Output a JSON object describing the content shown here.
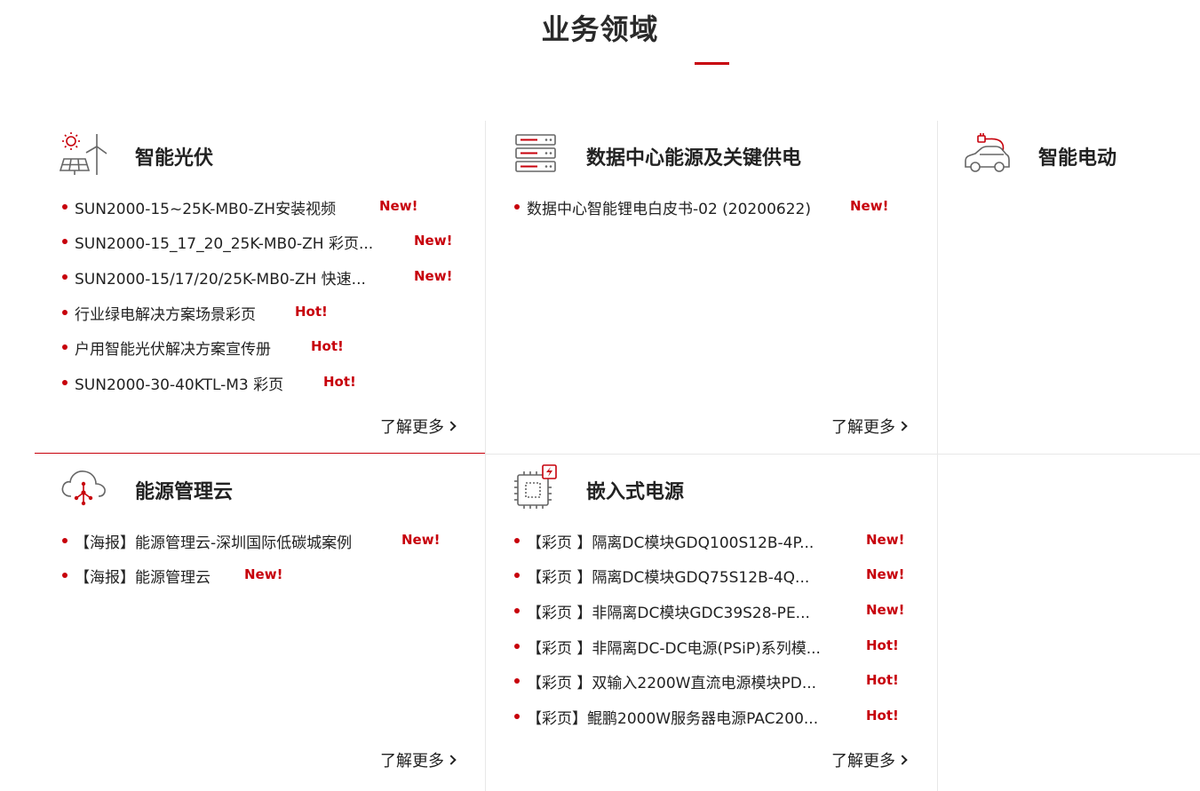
{
  "page": {
    "title": "业务领域"
  },
  "colors": {
    "accent": "#c7000b",
    "text": "#222222",
    "grid": "#e8e8e8"
  },
  "more_label": "了解更多",
  "cards": [
    {
      "id": "pv",
      "title": "智能光伏",
      "icon": "solar-wind-icon",
      "items": [
        {
          "text": "SUN2000-15~25K-MB0-ZH安装视频",
          "tag": "New!"
        },
        {
          "text": "SUN2000-15_17_20_25K-MB0-ZH 彩页...",
          "tag": "New!"
        },
        {
          "text": "SUN2000-15/17/20/25K-MB0-ZH 快速...",
          "tag": "New!"
        },
        {
          "text": "行业绿电解决方案场景彩页",
          "tag": "Hot!"
        },
        {
          "text": "户用智能光伏解决方案宣传册",
          "tag": "Hot!"
        },
        {
          "text": "SUN2000-30-40KTL-M3 彩页",
          "tag": "Hot!"
        }
      ]
    },
    {
      "id": "dc",
      "title": "数据中心能源及关键供电",
      "icon": "server-rack-icon",
      "items": [
        {
          "text": "数据中心智能锂电白皮书-02 (20200622)",
          "tag": "New!"
        }
      ]
    },
    {
      "id": "ev",
      "title": "智能电动",
      "icon": "electric-car-icon",
      "items": []
    },
    {
      "id": "cloud",
      "title": "能源管理云",
      "icon": "cloud-network-icon",
      "items": [
        {
          "text": "【海报】能源管理云-深圳国际低碳城案例",
          "tag": "New!"
        },
        {
          "text": "【海报】能源管理云",
          "tag": "New!"
        }
      ]
    },
    {
      "id": "embedded",
      "title": "嵌入式电源",
      "icon": "chip-power-icon",
      "items": [
        {
          "text": "【彩页 】隔离DC模块GDQ100S12B-4P...",
          "tag": "New!"
        },
        {
          "text": "【彩页 】隔离DC模块GDQ75S12B-4Q...",
          "tag": "New!"
        },
        {
          "text": "【彩页 】非隔离DC模块GDC39S28-PE...",
          "tag": "New!"
        },
        {
          "text": "【彩页 】非隔离DC-DC电源(PSiP)系列模...",
          "tag": "Hot!"
        },
        {
          "text": "【彩页 】双输入2200W直流电源模块PD...",
          "tag": "Hot!"
        },
        {
          "text": "【彩页】鲲鹏2000W服务器电源PAC200...",
          "tag": "Hot!"
        }
      ]
    }
  ]
}
